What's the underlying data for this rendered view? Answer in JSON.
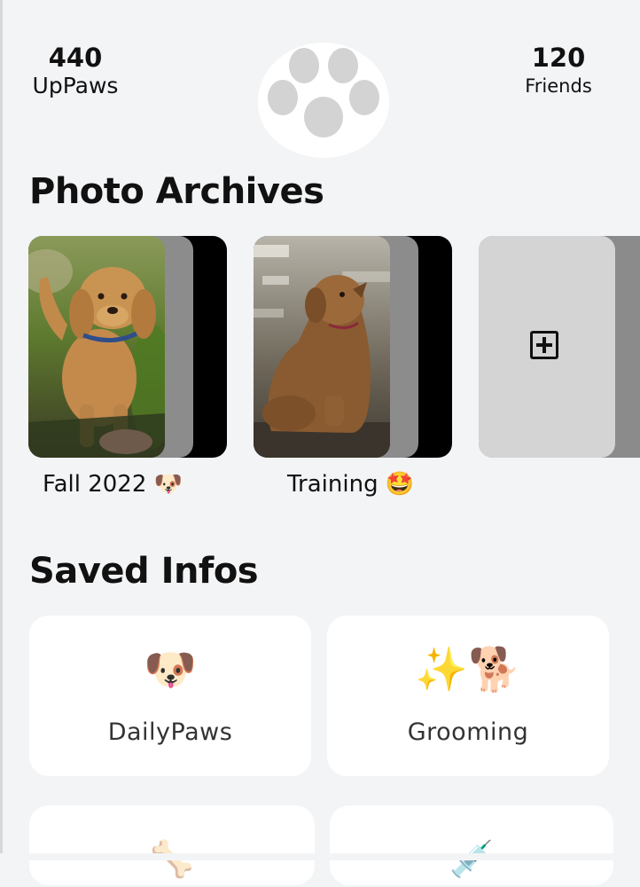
{
  "stats": {
    "left": {
      "value": "440",
      "label": "UpPaws"
    },
    "right": {
      "value": "120",
      "label": "Friends"
    }
  },
  "logo": {
    "icon": "paw-icon",
    "color": "#d3d3d3"
  },
  "photo_archives": {
    "title": "Photo Archives",
    "albums": [
      {
        "name": "Fall 2022 🐶",
        "icon": "dog-face-emoji",
        "thumbnail": "golden-doodle-puppy-photo"
      },
      {
        "name": "Training 🤩",
        "icon": "star-struck-emoji",
        "thumbnail": "fluffy-puppy-sitting-photo"
      }
    ],
    "add_album": {
      "icon": "plus-square-icon"
    }
  },
  "saved_infos": {
    "title": "Saved Infos",
    "cards": [
      {
        "label": "DailyPaws",
        "icon": "🐶"
      },
      {
        "label": "Grooming",
        "icon": "✨🐕"
      },
      {
        "label": "",
        "icon": "🦴"
      },
      {
        "label": "",
        "icon": "💉"
      }
    ]
  },
  "colors": {
    "background": "#f3f4f6",
    "card": "#ffffff",
    "text": "#111111"
  }
}
